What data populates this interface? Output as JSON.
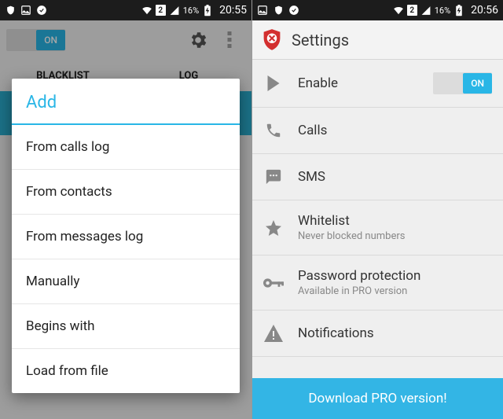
{
  "left": {
    "statusbar": {
      "battery_pct": "16%",
      "sim_num": "2",
      "time": "20:55"
    },
    "topbar": {
      "toggle_label": "ON"
    },
    "tabs": {
      "blacklist": "BLACKLIST",
      "log": "LOG"
    },
    "dialog": {
      "title": "Add",
      "items": [
        "From calls log",
        "From contacts",
        "From messages log",
        "Manually",
        "Begins with",
        "Load from file"
      ]
    }
  },
  "right": {
    "statusbar": {
      "battery_pct": "16%",
      "sim_num": "2",
      "time": "20:56"
    },
    "header": {
      "title": "Settings"
    },
    "rows": {
      "enable": {
        "label": "Enable",
        "toggle": "ON"
      },
      "calls": {
        "label": "Calls"
      },
      "sms": {
        "label": "SMS"
      },
      "whitelist": {
        "label": "Whitelist",
        "sub": "Never blocked numbers"
      },
      "password": {
        "label": "Password protection",
        "sub": "Available in PRO version"
      },
      "notifications": {
        "label": "Notifications"
      }
    },
    "pro_banner": "Download PRO version!"
  }
}
